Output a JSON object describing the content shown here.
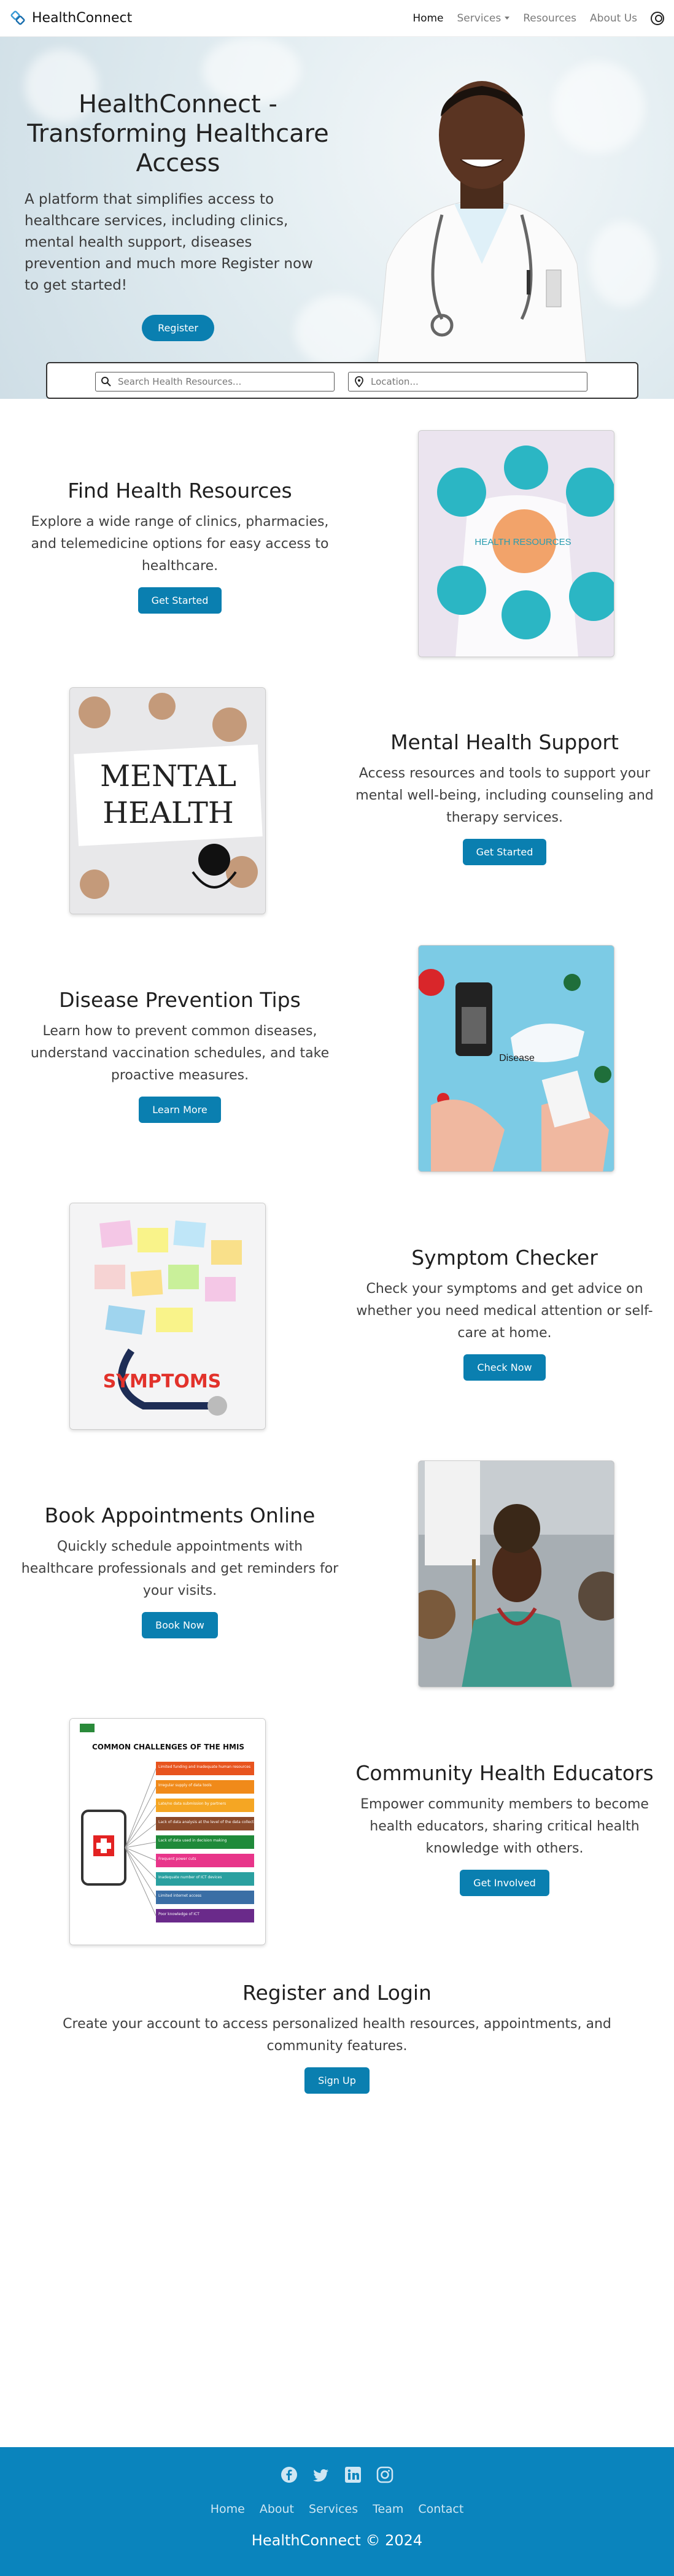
{
  "nav": {
    "brand": "HealthConnect",
    "links": [
      "Home",
      "Services",
      "Resources",
      "About Us"
    ]
  },
  "hero": {
    "title": "HealthConnect - Transforming Healthcare Access",
    "description": "A platform that simplifies access to healthcare services, including clinics, mental health support, diseases prevention and much more Register now to get started!",
    "button": "Register"
  },
  "search": {
    "resources_placeholder": "Search Health Resources...",
    "location_placeholder": "Location..."
  },
  "features": [
    {
      "title": "Find Health Resources",
      "description": "Explore a wide range of clinics, pharmacies, and telemedicine options for easy access to healthcare.",
      "button": "Get Started",
      "image_label": "HEALTH RESOURCES"
    },
    {
      "title": "Mental Health Support",
      "description": "Access resources and tools to support your mental well-being, including counseling and therapy services.",
      "button": "Get Started",
      "image_label": "MENTAL HEALTH"
    },
    {
      "title": "Disease Prevention Tips",
      "description": "Learn how to prevent common diseases, understand vaccination schedules, and take proactive measures.",
      "button": "Learn More",
      "image_label": "Disease"
    },
    {
      "title": "Symptom Checker",
      "description": "Check your symptoms and get advice on whether you need medical attention or self-care at home.",
      "button": "Check Now",
      "image_label": "SYMPTOMS"
    },
    {
      "title": "Book Appointments Online",
      "description": "Quickly schedule appointments with healthcare professionals and get reminders for your visits.",
      "button": "Book Now",
      "image_label": ""
    },
    {
      "title": "Community Health Educators",
      "description": "Empower community members to become health educators, sharing critical health knowledge with others.",
      "button": "Get Involved",
      "image_label": "COMMON CHALLENGES OF THE HMIS"
    }
  ],
  "hmis_items": [
    "Limited funding and Inadequate human resources",
    "Irregular supply of data tools",
    "Late/no data submission by partners",
    "Lack of data analysis at the level of the data collection",
    "Lack of data used in decision making",
    "Frequent power cuts",
    "Inadequate number of ICT devices",
    "Limited internet access",
    "Poor knowledge of ICT"
  ],
  "register": {
    "title": "Register and Login",
    "description": "Create your account to access personalized health resources, appointments, and community features.",
    "button": "Sign Up"
  },
  "footer": {
    "links": [
      "Home",
      "About",
      "Services",
      "Team",
      "Contact"
    ],
    "copyright": "HealthConnect © 2024"
  },
  "colors": {
    "primary": "#0a7fb0",
    "footer": "#0a84bd"
  }
}
